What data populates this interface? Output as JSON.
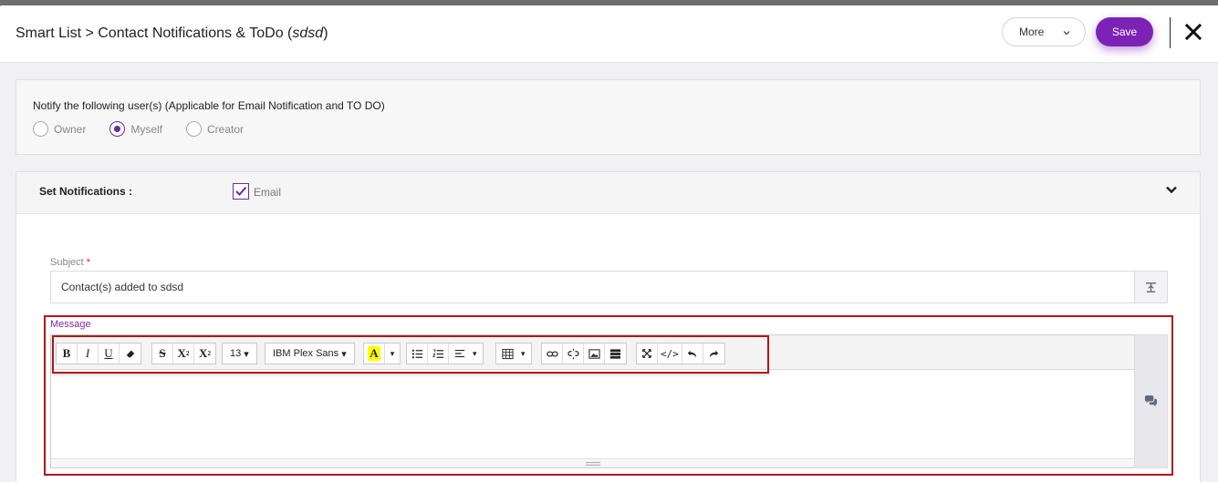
{
  "header": {
    "title_prefix": "Smart List > Contact Notifications & ToDo (",
    "title_italic": "sdsd",
    "title_suffix": ")",
    "more_label": "More",
    "save_label": "Save"
  },
  "notify": {
    "label": "Notify the following user(s) (Applicable for Email Notification and TO DO)",
    "options": [
      {
        "label": "Owner",
        "selected": false
      },
      {
        "label": "Myself",
        "selected": true
      },
      {
        "label": "Creator",
        "selected": false
      }
    ]
  },
  "notifications": {
    "label": "Set Notifications :",
    "email_label": "Email",
    "email_checked": true
  },
  "subject": {
    "label": "Subject",
    "required_mark": "*",
    "value": "Contact(s) added to sdsd"
  },
  "message": {
    "label": "Message",
    "toolbar": {
      "bold": "B",
      "italic": "I",
      "underline": "U",
      "superscript": "X",
      "subscript": "X",
      "font_size": "13",
      "font_name": "IBM Plex Sans",
      "highlight": "A"
    }
  },
  "colors": {
    "accent": "#7d22b7",
    "highlight_marker": "#ffff00",
    "annotation_outline": "#b01818"
  }
}
